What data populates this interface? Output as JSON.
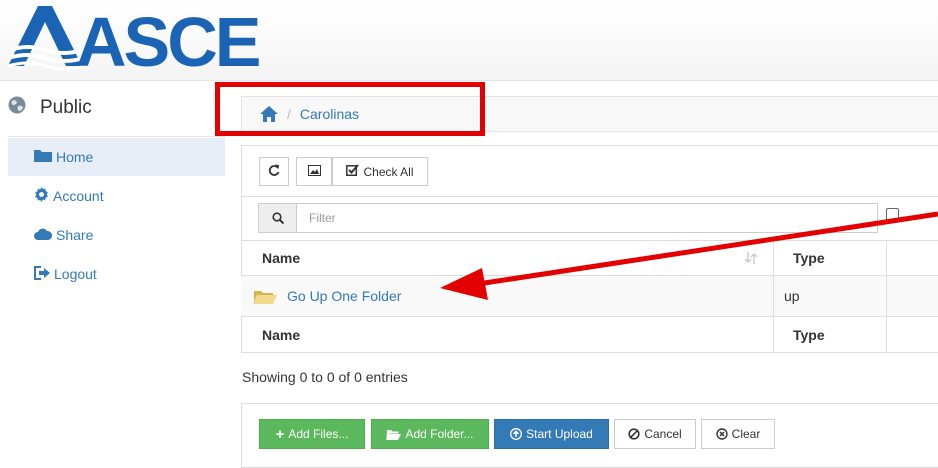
{
  "brand": {
    "logo_text": "ASCE",
    "color": "#1a63b5"
  },
  "sidebar": {
    "title": "Public",
    "items": [
      {
        "label": "Home",
        "icon": "folder-icon",
        "active": true
      },
      {
        "label": "Account",
        "icon": "gear-icon",
        "active": false
      },
      {
        "label": "Share",
        "icon": "cloud-icon",
        "active": false
      },
      {
        "label": "Logout",
        "icon": "sign-out-icon",
        "active": false
      }
    ]
  },
  "breadcrumb": {
    "home_icon": "home-icon",
    "separator": "/",
    "current": "Carolinas"
  },
  "toolbar": {
    "refresh_icon": "refresh-icon",
    "image_icon": "image-icon",
    "check_all_label": "Check All"
  },
  "filter": {
    "placeholder": "Filter",
    "search_icon": "search-icon"
  },
  "table": {
    "columns": [
      "Name",
      "Type"
    ],
    "rows": [
      {
        "name": "Go Up One Folder",
        "type": "up",
        "icon": "folder-open-icon"
      }
    ]
  },
  "info_text": "Showing 0 to 0 of 0 entries",
  "upload": {
    "add_files_label": "Add Files...",
    "add_folder_label": "Add Folder...",
    "start_upload_label": "Start Upload",
    "cancel_label": "Cancel",
    "clear_label": "Clear"
  },
  "colors": {
    "link": "#337ab7",
    "annotation_red": "#e30000",
    "success": "#5cb85c",
    "primary": "#337ab7"
  }
}
